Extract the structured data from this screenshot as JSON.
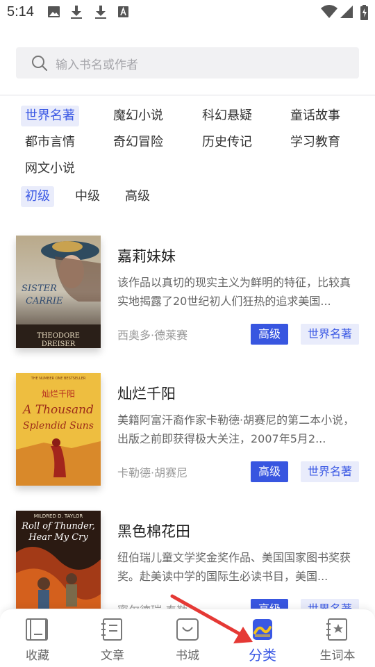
{
  "status_bar": {
    "time": "5:14"
  },
  "search": {
    "placeholder": "输入书名或作者"
  },
  "categories": [
    {
      "label": "世界名著",
      "active": true
    },
    {
      "label": "魔幻小说",
      "active": false
    },
    {
      "label": "科幻悬疑",
      "active": false
    },
    {
      "label": "童话故事",
      "active": false
    },
    {
      "label": "都市言情",
      "active": false
    },
    {
      "label": "奇幻冒险",
      "active": false
    },
    {
      "label": "历史传记",
      "active": false
    },
    {
      "label": "学习教育",
      "active": false
    },
    {
      "label": "网文小说",
      "active": false
    }
  ],
  "levels": [
    {
      "label": "初级",
      "active": true
    },
    {
      "label": "中级",
      "active": false
    },
    {
      "label": "高级",
      "active": false
    }
  ],
  "books": [
    {
      "title": "嘉莉妹妹",
      "description": "该作品以真切的现实主义为鲜明的特征，比较真实地揭露了20世纪初人们狂热的追求美国...",
      "author": "西奥多·德莱赛",
      "level": "高级",
      "category": "世界名著",
      "cover": {
        "title_line1": "SISTER",
        "title_line2": "CARRIE",
        "author_line1": "THEODORE",
        "author_line2": "DREISER"
      }
    },
    {
      "title": "灿烂千阳",
      "description": "美籍阿富汗裔作家卡勒德·胡赛尼的第二本小说，出版之前即获得极大关注，2007年5月2...",
      "author": "卡勒德·胡赛尼",
      "level": "高级",
      "category": "世界名著",
      "cover": {
        "top_text": "THE NUMBER ONE BESTSELLER",
        "chinese_title": "灿烂千阳",
        "title_line1": "A Thousand",
        "title_line2": "Splendid Suns"
      }
    },
    {
      "title": "黑色棉花田",
      "description": "纽伯瑞儿童文学奖金奖作品、美国国家图书奖获奖。赴美读中学的国际生必读书目，美国...",
      "author": "蜜尔德瑞·泰勒",
      "level": "高级",
      "category": "世界名著",
      "cover": {
        "author_line": "MILDRED D. TAYLOR",
        "title_line1": "Roll of Thunder,",
        "title_line2": "Hear My Cry"
      }
    }
  ],
  "bottom_nav": [
    {
      "label": "收藏",
      "icon": "collect-icon",
      "active": false
    },
    {
      "label": "文章",
      "icon": "article-icon",
      "active": false
    },
    {
      "label": "书城",
      "icon": "bookstore-icon",
      "active": false
    },
    {
      "label": "分类",
      "icon": "category-icon",
      "active": true
    },
    {
      "label": "生词本",
      "icon": "vocabulary-icon",
      "active": false
    }
  ],
  "colors": {
    "accent": "#3a58e4",
    "accent_bg": "#e9ecfb",
    "annotation": "#e53935"
  }
}
